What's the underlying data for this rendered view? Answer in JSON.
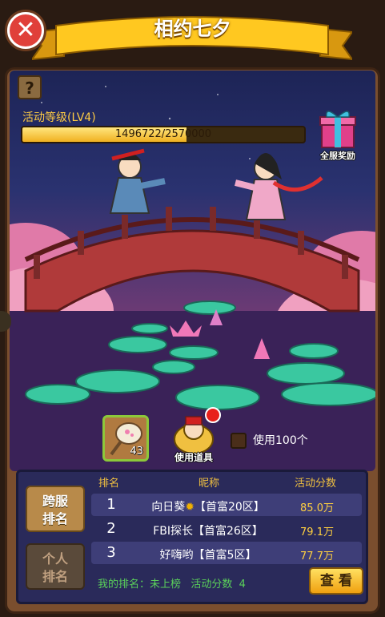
{
  "header": {
    "title": "相约七夕"
  },
  "activity": {
    "level_label": "活动等级(LV4)",
    "progress_current": 1496722,
    "progress_max": 2570000,
    "progress_text": "1496722/2570000"
  },
  "reward": {
    "label": "全服奖励"
  },
  "item": {
    "count": "43"
  },
  "use_item": {
    "label": "使用道具",
    "checkbox_label": "使用100个"
  },
  "tabs": {
    "cross_server": "跨服\n排名",
    "personal": "个人\n排名"
  },
  "ranking": {
    "headers": {
      "rank": "排名",
      "nickname": "昵称",
      "score": "活动分数"
    },
    "rows": [
      {
        "rank": "1",
        "name": "向日葵",
        "server": "【首富20区】",
        "score": "85.0万"
      },
      {
        "rank": "2",
        "name": "FBI探长",
        "server": "【首富26区】",
        "score": "79.1万"
      },
      {
        "rank": "3",
        "name": "好嗨哟",
        "server": "【首富5区】",
        "score": "77.7万"
      }
    ],
    "my_rank_text": "我的排名：未上榜   活动分数  4",
    "view_button": "查 看"
  },
  "colors": {
    "accent": "#f0c040",
    "score": "#ffd040",
    "my_rank": "#5ad05a"
  }
}
